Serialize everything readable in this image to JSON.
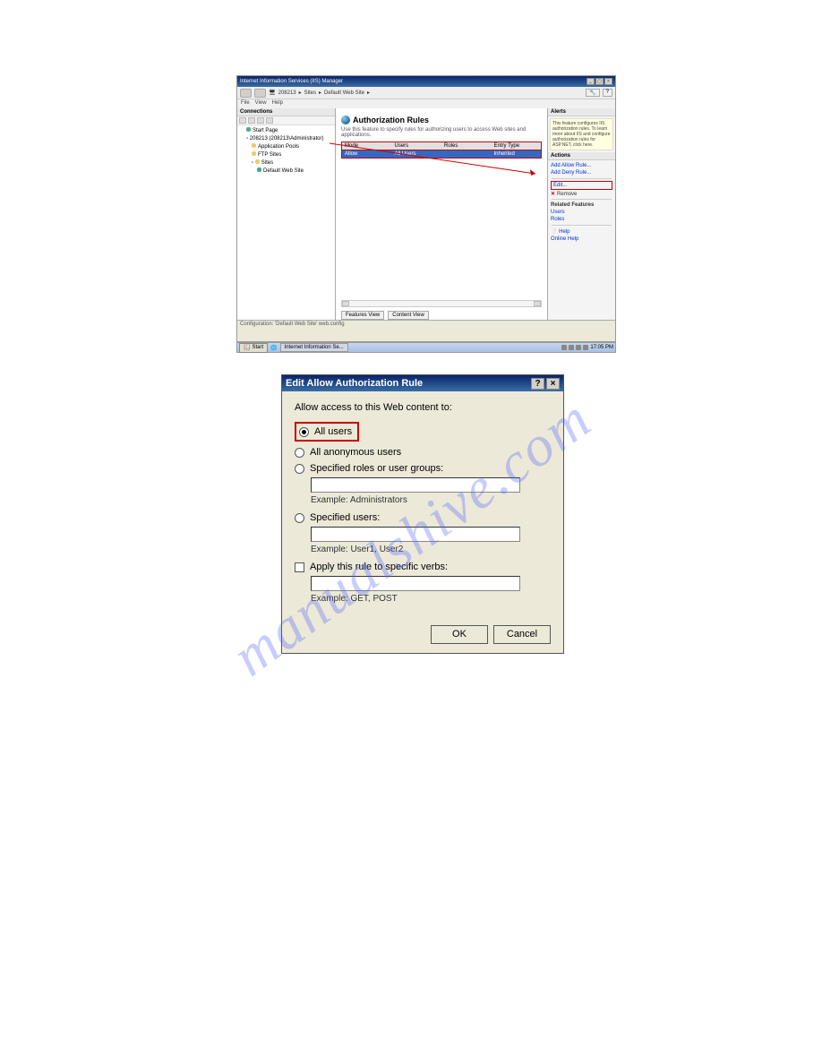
{
  "iis": {
    "title": "Internet Information Services (IIS) Manager",
    "breadcrumb": {
      "server": "208213",
      "sites": "Sites",
      "site": "Default Web Site"
    },
    "menu": {
      "file": "File",
      "view": "View",
      "help": "Help"
    },
    "connections": {
      "header": "Connections",
      "startPage": "Start Page",
      "server": "208213 (208213\\Administrator)",
      "appPools": "Application Pools",
      "ftpSites": "FTP Sites",
      "sites": "Sites",
      "defaultSite": "Default Web Site"
    },
    "center": {
      "heading": "Authorization Rules",
      "desc": "Use this feature to specify rules for authorizing users to access Web sites and applications.",
      "colMode": "Mode",
      "colUsers": "Users",
      "colRoles": "Roles",
      "colEntry": "Entry Type",
      "ruleMode": "Allow",
      "ruleUsers": "All Users",
      "ruleRoles": "",
      "ruleEntry": "Inherited",
      "tabFeatures": "Features View",
      "tabContent": "Content View"
    },
    "actions": {
      "alerts": "Alerts",
      "alertText": "This feature configures IIS authorization rules. To learn more about IIS and configure authorization rules for ASP.NET, click here.",
      "actionsHeader": "Actions",
      "addAllow": "Add Allow Rule...",
      "addDeny": "Add Deny Rule...",
      "edit": "Edit...",
      "remove": "Remove",
      "related": "Related Features",
      "users": "Users",
      "roles": "Roles",
      "help": "Help",
      "onlineHelp": "Online Help"
    },
    "status": "Configuration: 'Default Web Site' web.config",
    "taskbar": {
      "start": "Start",
      "task": "Internet Information Se...",
      "clock": "17:05 PM"
    }
  },
  "dialog": {
    "title": "Edit Allow Authorization Rule",
    "prompt": "Allow access to this Web content to:",
    "allUsers": "All users",
    "allAnon": "All anonymous users",
    "specRoles": "Specified roles or user groups:",
    "exRoles": "Example: Administrators",
    "specUsers": "Specified users:",
    "exUsers": "Example: User1, User2",
    "verbs": "Apply this rule to specific verbs:",
    "exVerbs": "Example: GET, POST",
    "ok": "OK",
    "cancel": "Cancel"
  },
  "watermark": "manualshive.com"
}
